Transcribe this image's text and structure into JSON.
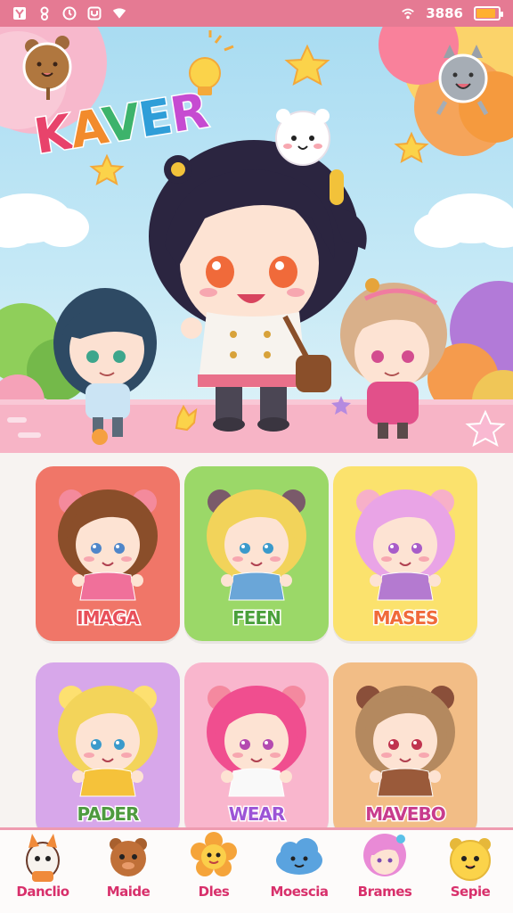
{
  "status_bar": {
    "time": "3886",
    "battery_level": 0.8,
    "icons": [
      "notification-y-icon",
      "bell-icon",
      "alarm-icon",
      "app-icon",
      "wifi-icon",
      "wifi-signal-icon",
      "battery-icon"
    ]
  },
  "hero": {
    "title_letters": [
      "K",
      "A",
      "V",
      "E",
      "R"
    ],
    "decorations": [
      "bear-sticker-icon",
      "lightbulb-icon",
      "cat-sticker-icon",
      "star-icon",
      "cloud-icon"
    ],
    "colors": {
      "sky": "#a9dcf2",
      "ground": "#f7b4c6"
    }
  },
  "cards": [
    {
      "label": "IMAGA",
      "bg": "#f07668",
      "text_color": "#e84f5a"
    },
    {
      "label": "FEEN",
      "bg": "#9bd868",
      "text_color": "#4aa03b"
    },
    {
      "label": "MASES",
      "bg": "#fbe26d",
      "text_color": "#f06a3a"
    },
    {
      "label": "PADER",
      "bg": "#d7a7ea",
      "text_color": "#4e9a3f"
    },
    {
      "label": "WEAR",
      "bg": "#f9b6cd",
      "text_color": "#9c54d6"
    },
    {
      "label": "MAVEBO",
      "bg": "#f2bd86",
      "text_color": "#c83c8d"
    }
  ],
  "bottom_nav": [
    {
      "label": "Danclio",
      "icon": "fox-icon"
    },
    {
      "label": "Maide",
      "icon": "bear-icon"
    },
    {
      "label": "Dles",
      "icon": "flower-icon"
    },
    {
      "label": "Moescia",
      "icon": "cloud-face-icon"
    },
    {
      "label": "Brames",
      "icon": "girl-avatar-icon"
    },
    {
      "label": "Sepie",
      "icon": "chick-icon"
    }
  ]
}
